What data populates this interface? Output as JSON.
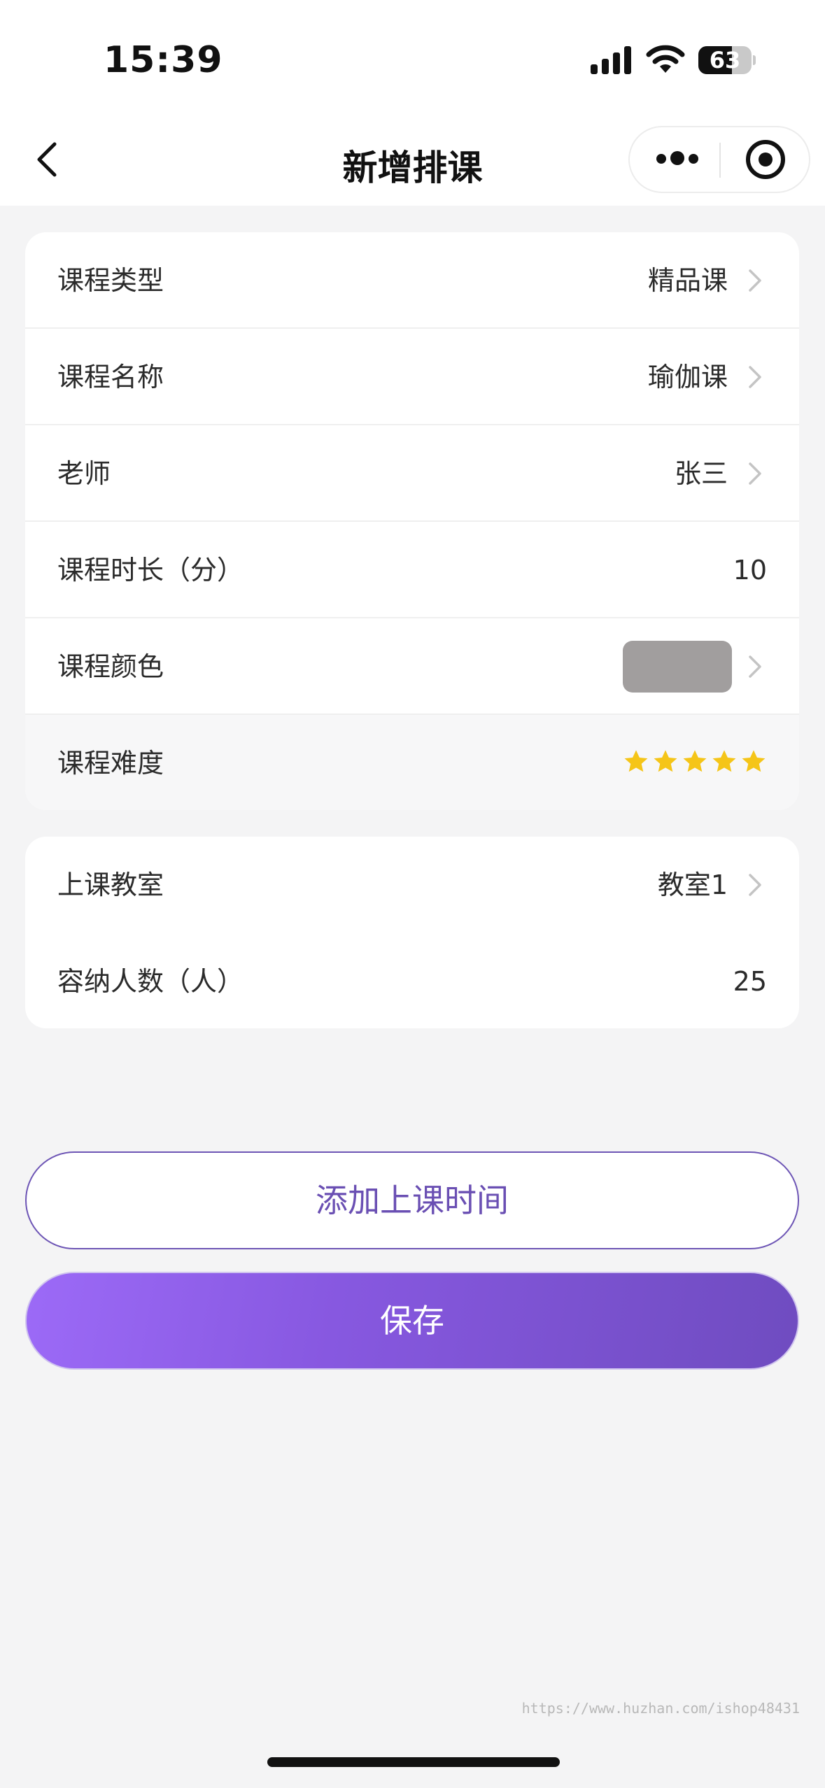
{
  "status_bar": {
    "time": "15:39",
    "battery_level": "63",
    "battery_fraction": 0.63,
    "icons": [
      "signal-icon",
      "wifi-icon",
      "battery-icon"
    ]
  },
  "nav": {
    "title": "新增排课",
    "back_icon": "chevron-left-icon",
    "more_icon": "more-dots-icon",
    "close_icon": "target-icon"
  },
  "course_card": {
    "rows": [
      {
        "label": "课程类型",
        "value": "精品课"
      },
      {
        "label": "课程名称",
        "value": "瑜伽课"
      },
      {
        "label": "老师",
        "value": "张三"
      },
      {
        "label": "课程时长（分）",
        "value": "10"
      },
      {
        "label": "课程颜色",
        "swatch_color": "#a19e9e"
      },
      {
        "label": "课程难度",
        "stars": 5,
        "max_stars": 5,
        "star_color": "#f5c518"
      }
    ]
  },
  "room_card": {
    "rows": [
      {
        "label": "上课教室",
        "value": "教室1"
      },
      {
        "label": "容纳人数（人）",
        "value": "25"
      }
    ]
  },
  "buttons": {
    "add_time": "添加上课时间",
    "save": "保存"
  },
  "watermark": "https://www.huzhan.com/ishop48431",
  "colors": {
    "accent": "#6a4fb3",
    "gradient_start": "#9c6af7",
    "gradient_end": "#6f4cc0"
  }
}
